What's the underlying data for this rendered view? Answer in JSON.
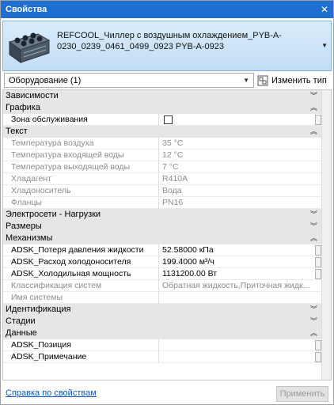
{
  "window": {
    "title": "Свойства"
  },
  "type_selector": {
    "name": "REFCOOL_Чиллер с воздушным охлаждением_PYB-A-0230_0239_0461_0499_0923 PYB-A-0923"
  },
  "instance": {
    "selected": "Оборудование (1)",
    "edit_type_label": "Изменить тип"
  },
  "groups": {
    "dependencies": "Зависимости",
    "graphics": "Графика",
    "text": "Текст",
    "electrical": "Электросети - Нагрузки",
    "dimensions": "Размеры",
    "mechanical": "Механизмы",
    "identity": "Идентификация",
    "phasing": "Стадии",
    "data": "Данные"
  },
  "props": {
    "service_zone": {
      "label": "Зона обслуживания",
      "checked": false
    },
    "air_temp": {
      "label": "Температура воздуха",
      "value": "35 °C"
    },
    "water_in_temp": {
      "label": "Температура входящей воды",
      "value": "12 °C"
    },
    "water_out_temp": {
      "label": "Температура выходящей воды",
      "value": "7 °C"
    },
    "refrigerant": {
      "label": "Хладагент",
      "value": "R410A"
    },
    "coolant": {
      "label": "Хладоноситель",
      "value": "Вода"
    },
    "flanges": {
      "label": "Фланцы",
      "value": "PN16"
    },
    "pressure_loss": {
      "label": "ADSK_Потеря давления жидкости",
      "value": "52.58000 кПа"
    },
    "chilled_flow": {
      "label": "ADSK_Расход холодоносителя",
      "value": "199.4000 м³/ч"
    },
    "cooling_power": {
      "label": "ADSK_Холодильная мощность",
      "value": "1131200.00 Вт"
    },
    "system_class": {
      "label": "Классификация систем",
      "value": "Обратная жидкость,Приточная жидк..."
    },
    "system_name": {
      "label": "Имя системы",
      "value": ""
    },
    "position": {
      "label": "ADSK_Позиция",
      "value": ""
    },
    "note": {
      "label": "ADSK_Примечание",
      "value": ""
    }
  },
  "footer": {
    "help_label": "Справка по свойствам",
    "apply_label": "Применить"
  }
}
